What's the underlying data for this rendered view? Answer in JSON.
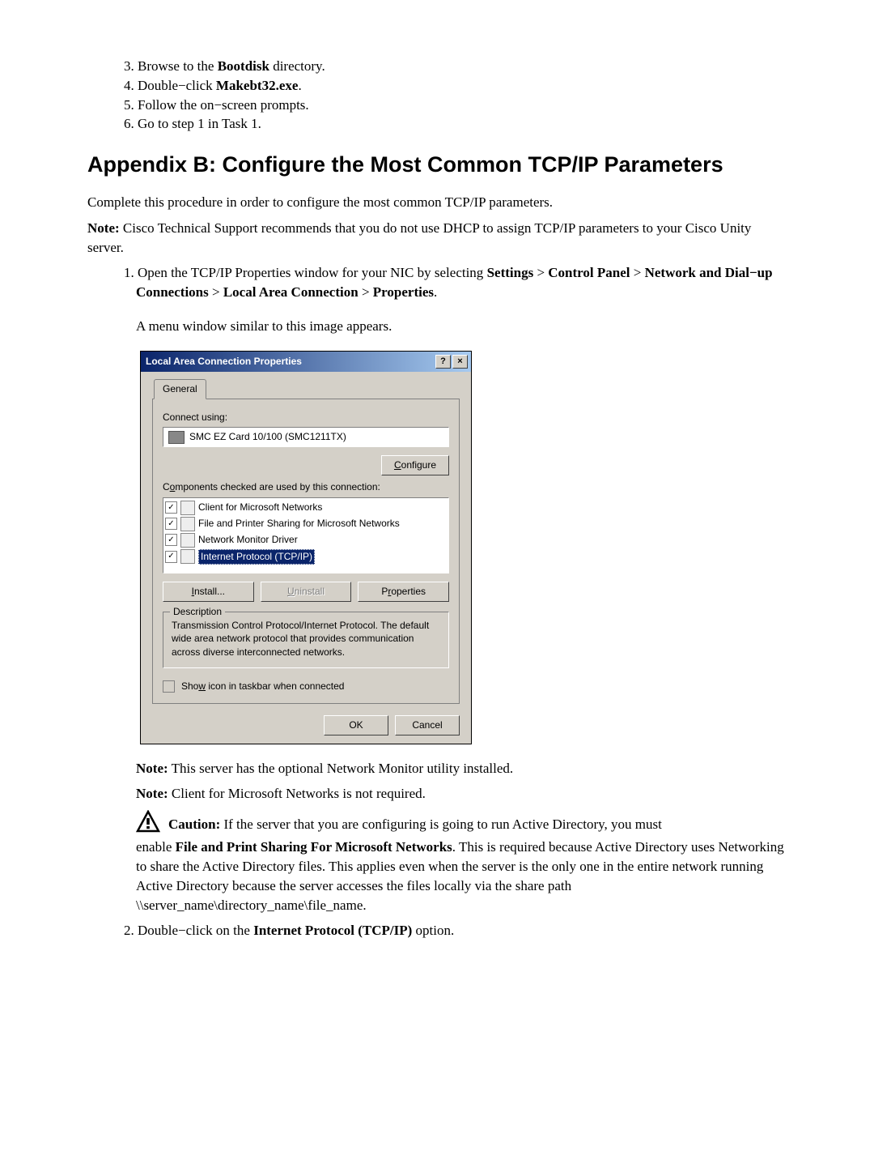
{
  "list1": {
    "i3_a": "Browse to the ",
    "i3_b": "Bootdisk",
    "i3_c": " directory.",
    "i4_a": "Double−click ",
    "i4_b": "Makebt32.exe",
    "i4_c": ".",
    "i5": "Follow the on−screen prompts.",
    "i6": "Go to step 1 in Task 1."
  },
  "heading": "Appendix B: Configure the Most Common TCP/IP Parameters",
  "intro": "Complete this procedure in order to configure the most common TCP/IP parameters.",
  "note1_label": "Note:",
  "note1_text": " Cisco Technical Support recommends that you do not use DHCP to assign TCP/IP parameters to your Cisco Unity server.",
  "step1": {
    "a": "Open the TCP/IP Properties window for your NIC by selecting ",
    "b1": "Settings",
    "gt": " > ",
    "b2": "Control Panel",
    "b3": "Network and Dial−up Connections",
    "b4": "Local Area Connection",
    "b5": "Properties",
    "dot": ".",
    "after": "A menu window similar to this image appears."
  },
  "dialog": {
    "title": "Local Area Connection Properties",
    "help": "?",
    "close": "×",
    "tab": "General",
    "connect_using": "Connect using:",
    "adapter": "SMC EZ Card 10/100 (SMC1211TX)",
    "configure": "Configure",
    "configure_u": "C",
    "components_label_a": "C",
    "components_label_b": "o",
    "components_label_c": "mponents checked are used by this connection:",
    "components": [
      "Client for Microsoft Networks",
      "File and Printer Sharing for Microsoft Networks",
      "Network Monitor Driver",
      "Internet Protocol (TCP/IP)"
    ],
    "install": "Install...",
    "install_u": "I",
    "uninstall": "Uninstall",
    "uninstall_u": "U",
    "properties": "Properties",
    "properties_u": "P",
    "desc_title": "Description",
    "desc": "Transmission Control Protocol/Internet Protocol. The default wide area network protocol that provides communication across diverse interconnected networks.",
    "show_a": "Sho",
    "show_u": "w",
    "show_b": " icon in taskbar when connected",
    "ok": "OK",
    "cancel": "Cancel"
  },
  "note2_label": "Note:",
  "note2_text": " This server has the optional Network Monitor utility installed.",
  "note3_label": "Note:",
  "note3_text": " Client for Microsoft Networks is not required.",
  "caution_label": "Caution:",
  "caution_first": " If the server that you are configuring is going to run Active Directory, you must",
  "caution_rest_a": "enable ",
  "caution_rest_b": "File and Print Sharing For Microsoft Networks",
  "caution_rest_c": ". This is required because Active Directory uses Networking to share the Active Directory files. This applies even when the server is the only one in the entire network running Active Directory because the server accesses the files locally via the share path \\\\server_name\\directory_name\\file_name.",
  "step2_a": "Double−click on the ",
  "step2_b": "Internet Protocol (TCP/IP)",
  "step2_c": " option."
}
